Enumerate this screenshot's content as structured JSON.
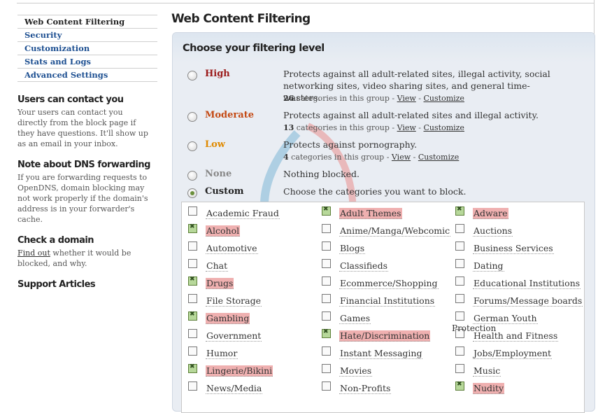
{
  "sidebar": {
    "nav": [
      "Web Content Filtering",
      "Security",
      "Customization",
      "Stats and Logs",
      "Advanced Settings"
    ],
    "contact_title": "Users can contact you",
    "contact_text": "Your users can contact you directly from the block page if they have questions. It'll show up as an email in your inbox.",
    "dns_title": "Note about DNS forwarding",
    "dns_text": "If you are forwarding requests to OpenDNS, domain blocking may not work properly if the domain's address is in your forwarder's cache.",
    "check_title": "Check a domain",
    "check_link": "Find out",
    "check_text": " whether it would be blocked, and why.",
    "support_title": "Support Articles"
  },
  "main": {
    "page_title": "Web Content Filtering",
    "panel_title": "Choose your filtering level",
    "levels": [
      {
        "name": "High",
        "color": "#9b1a1a",
        "selected": false,
        "desc": "Protects against all adult-related sites, illegal activity, social networking sites, video sharing sites, and general time-wasters.",
        "count": "26",
        "meta_text": " categories in this group - ",
        "view": "View",
        "sep": " - ",
        "customize": "Customize"
      },
      {
        "name": "Moderate",
        "color": "#c44a14",
        "selected": false,
        "desc": "Protects against all adult-related sites and illegal activity.",
        "count": "13",
        "meta_text": " categories in this group - ",
        "view": "View",
        "sep": " - ",
        "customize": "Customize"
      },
      {
        "name": "Low",
        "color": "#e08a00",
        "selected": false,
        "desc": "Protects against pornography.",
        "count": "4",
        "meta_text": " categories in this group - ",
        "view": "View",
        "sep": " - ",
        "customize": "Customize"
      },
      {
        "name": "None",
        "color": "#888888",
        "selected": false,
        "desc": "Nothing blocked."
      },
      {
        "name": "Custom",
        "color": "#222222",
        "selected": true,
        "desc": "Choose the categories you want to block."
      }
    ],
    "categories": [
      [
        {
          "label": "Academic Fraud",
          "checked": false
        },
        {
          "label": "Alcohol",
          "checked": true
        },
        {
          "label": "Automotive",
          "checked": false
        },
        {
          "label": "Chat",
          "checked": false
        },
        {
          "label": "Drugs",
          "checked": true
        },
        {
          "label": "File Storage",
          "checked": false
        },
        {
          "label": "Gambling",
          "checked": true
        },
        {
          "label": "Government",
          "checked": false
        },
        {
          "label": "Humor",
          "checked": false
        },
        {
          "label": "Lingerie/Bikini",
          "checked": true
        },
        {
          "label": "News/Media",
          "checked": false
        }
      ],
      [
        {
          "label": "Adult Themes",
          "checked": true
        },
        {
          "label": "Anime/Manga/Webcomic",
          "checked": false
        },
        {
          "label": "Blogs",
          "checked": false
        },
        {
          "label": "Classifieds",
          "checked": false
        },
        {
          "label": "Ecommerce/Shopping",
          "checked": false
        },
        {
          "label": "Financial Institutions",
          "checked": false
        },
        {
          "label": "Games",
          "checked": false
        },
        {
          "label": "Hate/Discrimination",
          "checked": true
        },
        {
          "label": "Instant Messaging",
          "checked": false
        },
        {
          "label": "Movies",
          "checked": false
        },
        {
          "label": "Non-Profits",
          "checked": false
        }
      ],
      [
        {
          "label": "Adware",
          "checked": true
        },
        {
          "label": "Auctions",
          "checked": false
        },
        {
          "label": "Business Services",
          "checked": false
        },
        {
          "label": "Dating",
          "checked": false
        },
        {
          "label": "Educational Institutions",
          "checked": false
        },
        {
          "label": "Forums/Message boards",
          "checked": false
        },
        {
          "label": "German Youth",
          "checked": false
        },
        {
          "label": "Health and Fitness",
          "checked": false
        },
        {
          "label": "Jobs/Employment",
          "checked": false
        },
        {
          "label": "Music",
          "checked": false
        },
        {
          "label": "Nudity",
          "checked": true
        }
      ]
    ],
    "overlap_text": "Protection"
  }
}
